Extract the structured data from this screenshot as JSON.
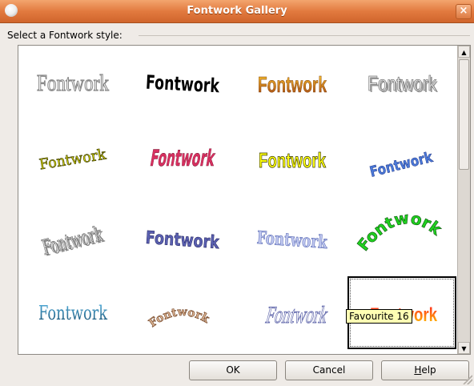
{
  "window": {
    "title": "Fontwork Gallery"
  },
  "section_label": "Select a Fontwork style:",
  "gallery": {
    "items": [
      {
        "text": "Fontwork",
        "style": "outline-gray"
      },
      {
        "text": "Fontwork",
        "style": "black-wave"
      },
      {
        "text": "Fontwork",
        "style": "orange-gradient"
      },
      {
        "text": "Fontwork",
        "style": "silver-3d"
      },
      {
        "text": "Fontwork",
        "style": "olive-slanted"
      },
      {
        "text": "Fontwork",
        "style": "red-perspective"
      },
      {
        "text": "Fontwork",
        "style": "yellow-bold"
      },
      {
        "text": "Fontwork",
        "style": "blue-rising"
      },
      {
        "text": "Fontwork",
        "style": "gray-3d-slant"
      },
      {
        "text": "Fontwork",
        "style": "navy-arched"
      },
      {
        "text": "Fontwork",
        "style": "lavender-arch"
      },
      {
        "text": "Fontwork",
        "style": "green-arc"
      },
      {
        "text": "Fontwork",
        "style": "teal-gradient"
      },
      {
        "text": "Fontwork",
        "style": "brown-arch"
      },
      {
        "text": "Fontwork",
        "style": "lavender-outline"
      },
      {
        "text": "Fontwork",
        "style": "red-orange-selected"
      }
    ],
    "selected_index": 15,
    "tooltip": "Favourite 16"
  },
  "buttons": {
    "ok": "OK",
    "cancel": "Cancel",
    "help_first": "H",
    "help_rest": "elp"
  },
  "colors": {
    "titlebar": "#e27a3f",
    "tooltip_bg": "#ffffb4"
  }
}
